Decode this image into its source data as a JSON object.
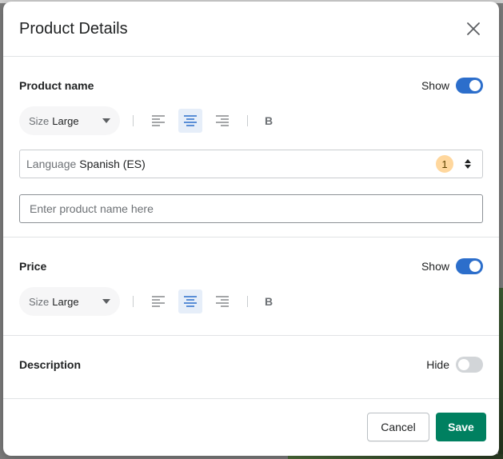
{
  "modal": {
    "title": "Product Details"
  },
  "product_name": {
    "label": "Product name",
    "toggle_label": "Show",
    "toggle_on": true,
    "size": {
      "label": "Size",
      "value": "Large"
    },
    "alignment": "center",
    "bold_label": "B",
    "language": {
      "label": "Language",
      "value": "Spanish (ES)",
      "badge_count": "1"
    },
    "input_placeholder": "Enter product name here"
  },
  "price": {
    "label": "Price",
    "toggle_label": "Show",
    "toggle_on": true,
    "size": {
      "label": "Size",
      "value": "Large"
    },
    "alignment": "center",
    "bold_label": "B"
  },
  "description": {
    "label": "Description",
    "toggle_label": "Hide",
    "toggle_on": false
  },
  "footer": {
    "cancel_label": "Cancel",
    "save_label": "Save"
  },
  "colors": {
    "accent": "#2c6ecb",
    "primary_button": "#008060",
    "badge": "#ffd79d"
  },
  "icons": [
    "close-icon",
    "chevron-down-icon",
    "align-left-icon",
    "align-center-icon",
    "align-right-icon",
    "select-updown-icon"
  ]
}
